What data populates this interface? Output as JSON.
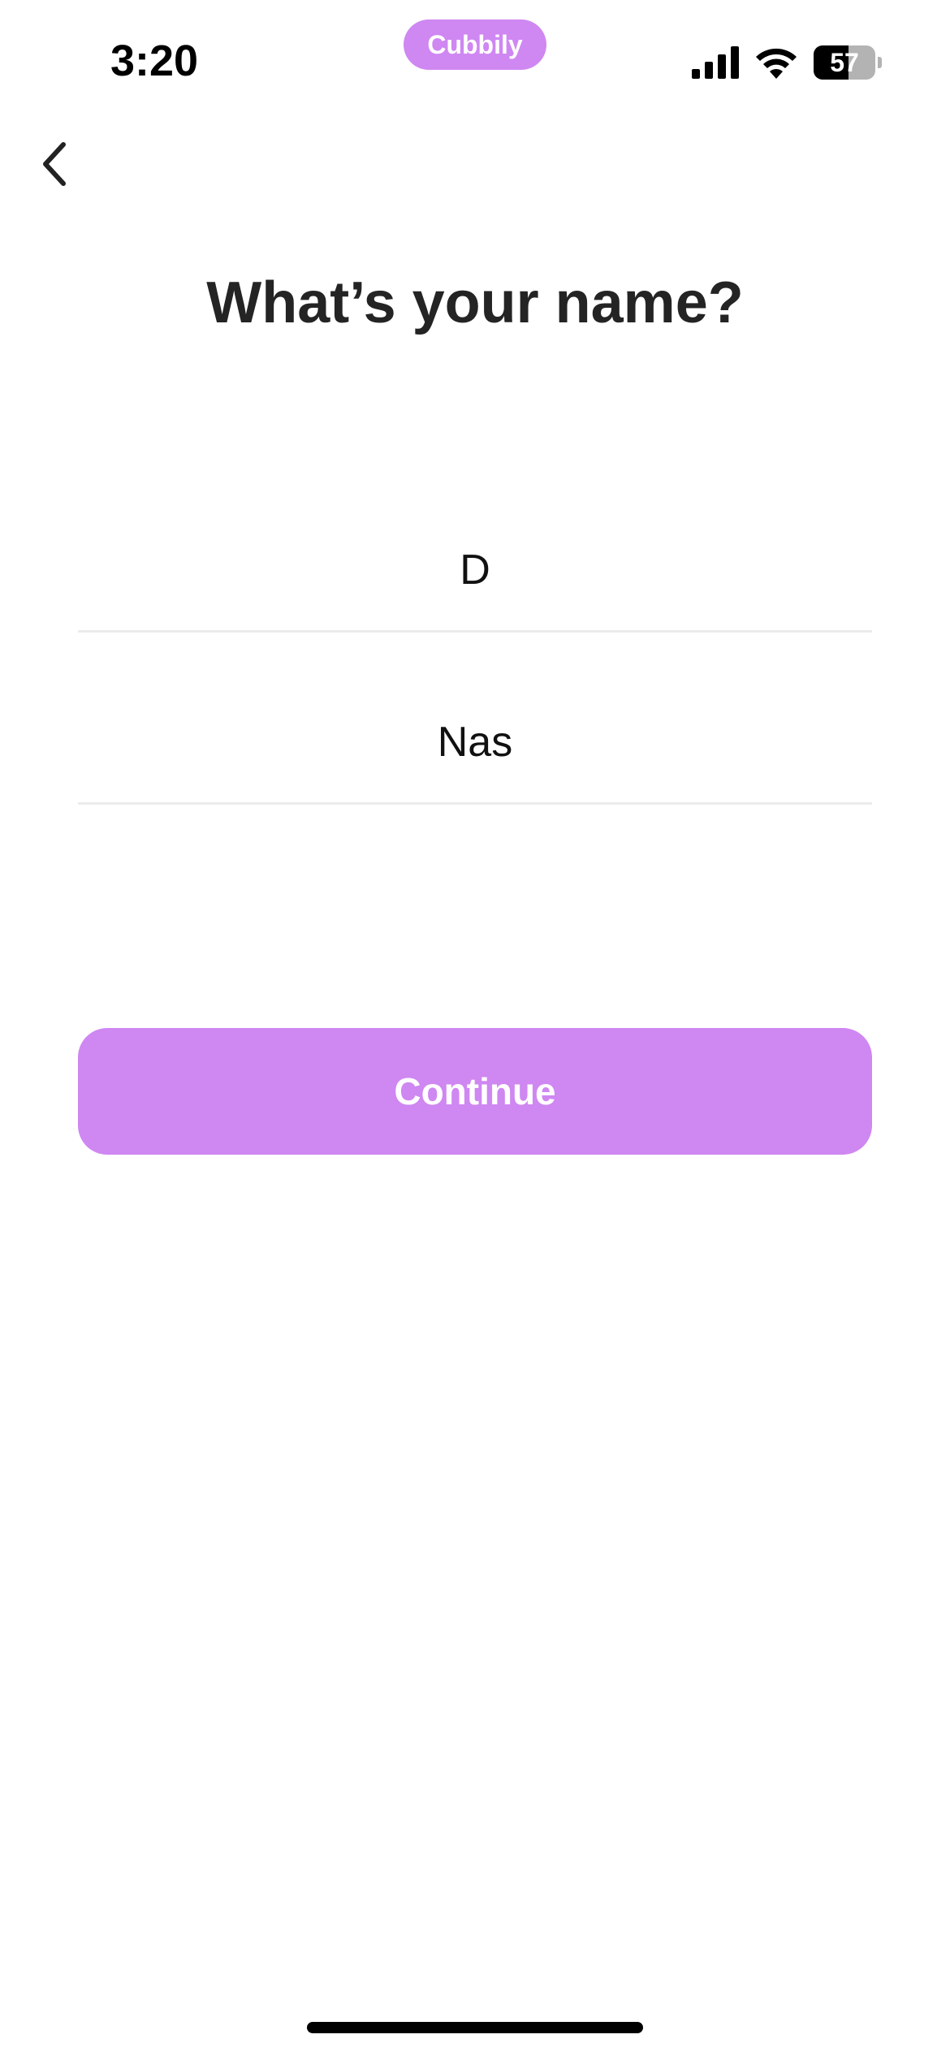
{
  "status_bar": {
    "time": "3:20",
    "app_pill_label": "Cubbily",
    "battery_level": "57",
    "battery_fraction": 0.57,
    "icons": [
      "signal-icon",
      "wifi-icon",
      "battery-icon"
    ]
  },
  "nav": {
    "back_icon": "chevron-left-icon"
  },
  "form": {
    "title": "What’s your name?",
    "first_name_value": "D",
    "last_name_value": "Nas",
    "continue_label": "Continue"
  },
  "colors": {
    "accent": "#cf87f2",
    "title_text": "#242424",
    "divider": "#ebebeb",
    "background": "#ffffff"
  }
}
